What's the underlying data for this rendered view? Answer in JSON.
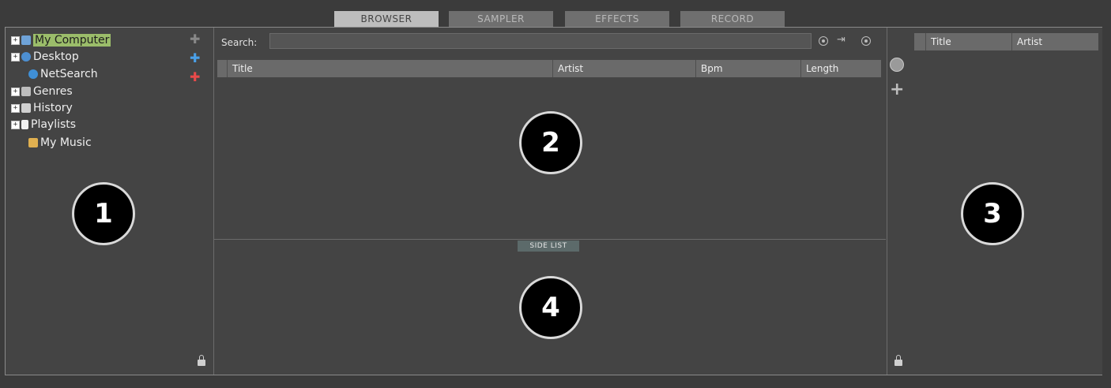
{
  "tabs": [
    {
      "label": "BROWSER",
      "active": true
    },
    {
      "label": "SAMPLER",
      "active": false
    },
    {
      "label": "EFFECTS",
      "active": false
    },
    {
      "label": "RECORD",
      "active": false
    }
  ],
  "tree": {
    "items": [
      {
        "label": "My Computer",
        "selected": true,
        "expandable": true,
        "icon": "computer-icon"
      },
      {
        "label": "Desktop",
        "selected": false,
        "expandable": true,
        "icon": "desktop-icon"
      },
      {
        "label": "NetSearch",
        "selected": false,
        "expandable": false,
        "icon": "globe-icon"
      },
      {
        "label": "Genres",
        "selected": false,
        "expandable": true,
        "icon": "genres-icon"
      },
      {
        "label": "History",
        "selected": false,
        "expandable": true,
        "icon": "history-icon"
      },
      {
        "label": "Playlists",
        "selected": false,
        "expandable": true,
        "icon": "playlist-icon"
      },
      {
        "label": "My Music",
        "selected": false,
        "expandable": false,
        "icon": "music-folder-icon"
      }
    ]
  },
  "search": {
    "label": "Search:",
    "value": ""
  },
  "browser_columns": [
    "Title",
    "Artist",
    "Bpm",
    "Length"
  ],
  "side_list_label": "SIDE LIST",
  "right_columns": [
    "Title",
    "Artist"
  ],
  "badges": [
    "1",
    "2",
    "3",
    "4"
  ],
  "colors": {
    "selected_bg": "#9bbd6a",
    "tab_active": "#bdbdbd",
    "tab_inactive": "#6f6f6f"
  }
}
